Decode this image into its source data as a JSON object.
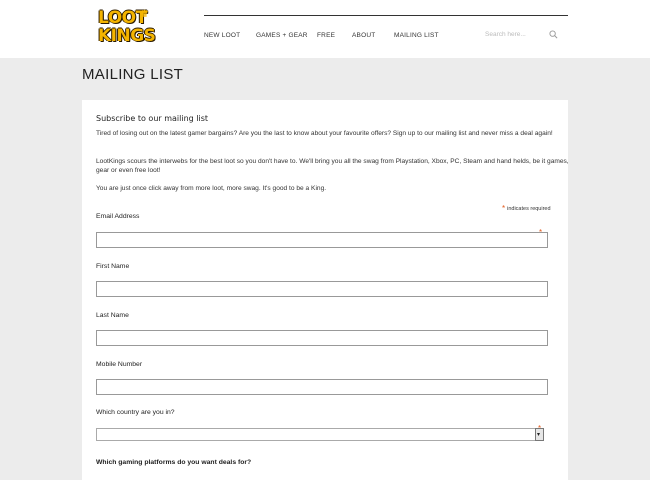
{
  "header": {
    "logo_line1": "LOOT",
    "logo_line2": "KINGS",
    "nav": [
      "NEW LOOT",
      "GAMES + GEAR",
      "FREE",
      "ABOUT",
      "MAILING LIST"
    ],
    "search_placeholder": "Search here..."
  },
  "page_title": "MAILING LIST",
  "form": {
    "title": "Subscribe to our mailing list",
    "paragraphs": [
      "Tired of losing out on the latest gamer bargains? Are you the last to know about your favourite offers? Sign up to our mailing list and never miss a deal again!",
      "LootKings scours the interwebs for the best loot so you don't have to. We'll bring you all the swag from Playstation, Xbox, PC, Steam and hand helds, be it games, gear or even free loot!",
      "You are just once click away from more loot, more swag. It's good to be a King."
    ],
    "required_note": "indicates required",
    "fields": [
      {
        "label": "Email Address",
        "value": "",
        "required": true
      },
      {
        "label": "First Name",
        "value": ""
      },
      {
        "label": "Last Name",
        "value": ""
      },
      {
        "label": "Mobile Number",
        "value": ""
      }
    ],
    "country": {
      "label": "Which country are you in?",
      "selected": ""
    },
    "platforms_label": "Which gaming platforms do you want deals for?"
  },
  "colors": {
    "accent": "#e35b1c",
    "logo": "#f4b400",
    "background": "#ececec"
  }
}
